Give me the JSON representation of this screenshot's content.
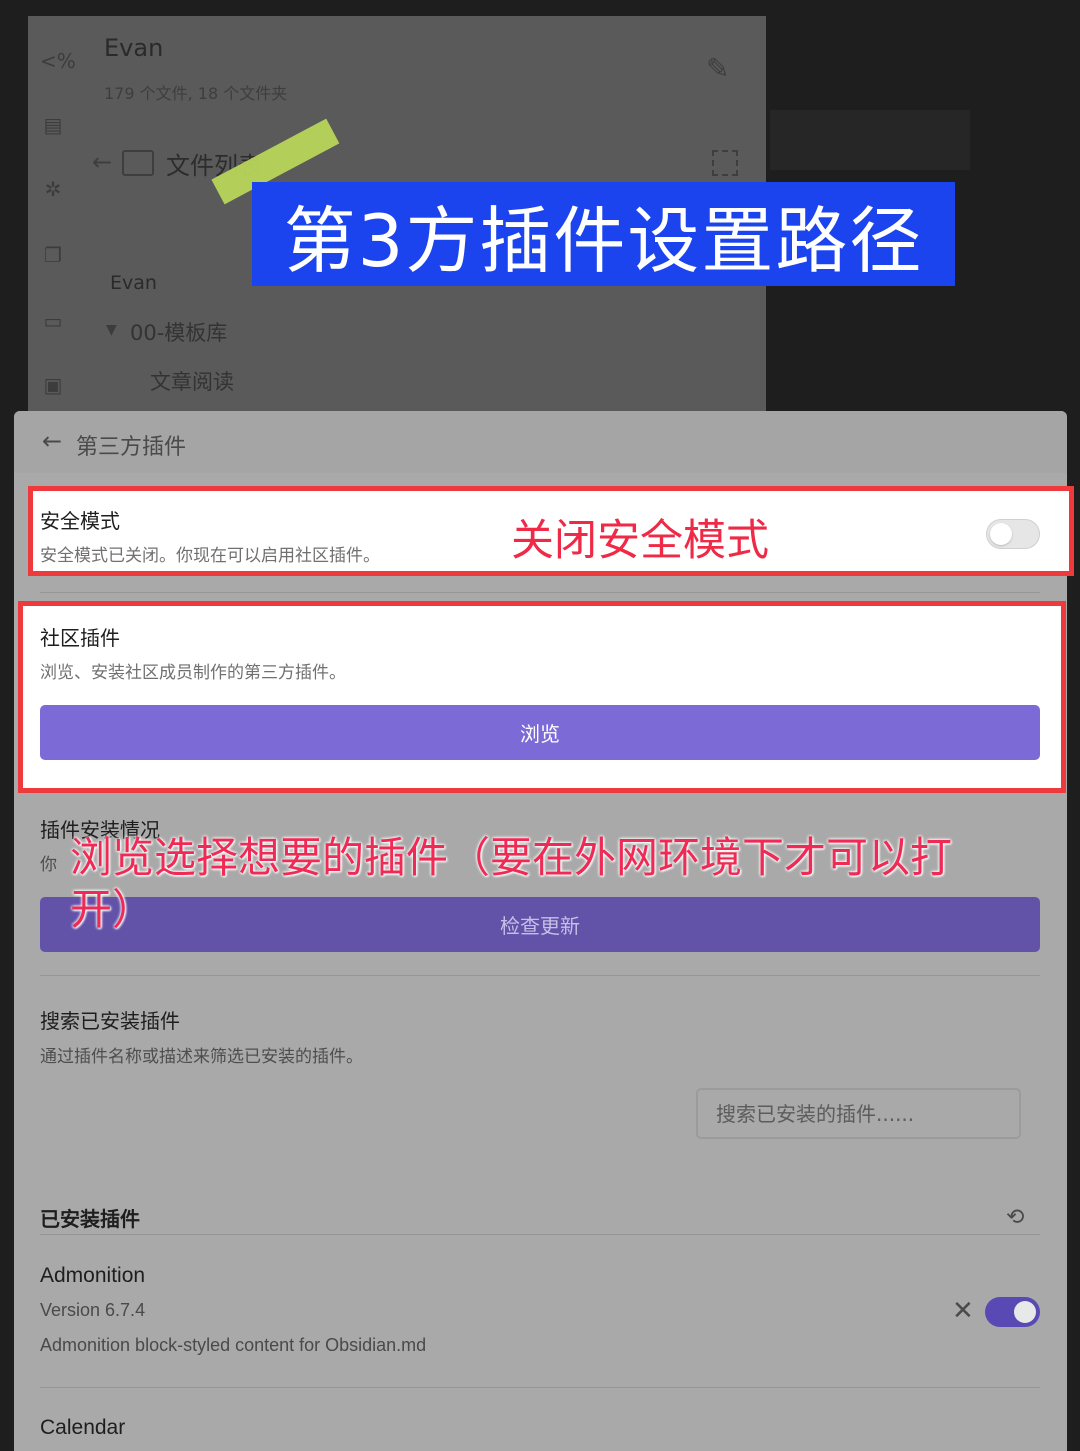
{
  "background": {
    "vault_name": "Evan",
    "vault_meta": "179 个文件, 18 个文件夹",
    "file_list_title": "文件列表",
    "tree_root": "Evan",
    "tree_folder": "00-模板库",
    "tree_file": "文章阅读",
    "rail_icons": [
      "code-icon",
      "note-icon",
      "graph-icon",
      "copy-icon",
      "cards-icon",
      "archive-icon"
    ]
  },
  "annotations": {
    "title": "第3方插件设置路径",
    "safe_mode_note": "关闭安全模式",
    "browse_note_line1": "浏览选择想要的插件（要在外网环境下才可以打",
    "browse_note_line2": "开）"
  },
  "modal": {
    "title": "第三方插件",
    "safe_mode": {
      "name": "安全模式",
      "desc": "安全模式已关闭。你现在可以启用社区插件。",
      "enabled": false
    },
    "community": {
      "name": "社区插件",
      "desc": "浏览、安装社区成员制作的第三方插件。",
      "button": "浏览"
    },
    "install_status": {
      "name": "插件安装情况",
      "desc_visible": "你",
      "button": "检查更新"
    },
    "search": {
      "name": "搜索已安装插件",
      "desc": "通过插件名称或描述来筛选已安装的插件。",
      "placeholder": "搜索已安装的插件......"
    },
    "installed": {
      "header": "已安装插件",
      "plugins": [
        {
          "name": "Admonition",
          "version": "Version 6.7.4",
          "desc": "Admonition block-styled content for Obsidian.md",
          "enabled": true
        },
        {
          "name": "Calendar"
        }
      ]
    }
  },
  "colors": {
    "accent": "#7c6bd6",
    "banner": "#1b44ee",
    "annotation_red": "#ef2a47",
    "frame_red": "#ef3a3d"
  }
}
